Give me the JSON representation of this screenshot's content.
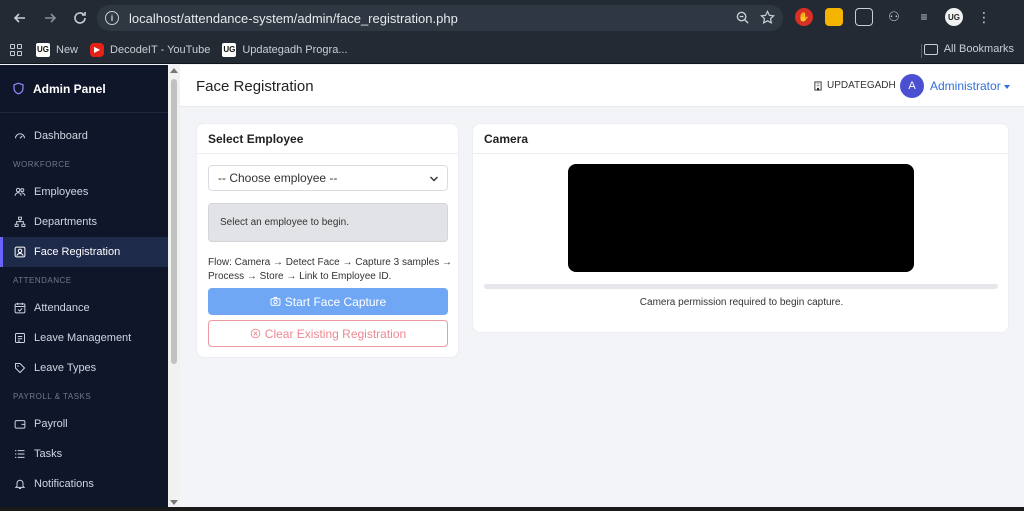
{
  "browser": {
    "url": "localhost/attendance-system/admin/face_registration.php",
    "bookmarks": [
      {
        "label": "New",
        "icon": "ug-favicon"
      },
      {
        "label": "DecodeIT - YouTube",
        "icon": "youtube-favicon"
      },
      {
        "label": "Updategadh Progra...",
        "icon": "ug-favicon"
      }
    ],
    "all_bookmarks": "All Bookmarks",
    "profile_initials": "UG"
  },
  "sidebar": {
    "brand": "Admin Panel",
    "items": [
      {
        "type": "item",
        "label": "Dashboard",
        "icon": "dashboard-icon"
      },
      {
        "type": "section",
        "label": "WORKFORCE"
      },
      {
        "type": "item",
        "label": "Employees",
        "icon": "people-icon"
      },
      {
        "type": "item",
        "label": "Departments",
        "icon": "sitemap-icon"
      },
      {
        "type": "item",
        "label": "Face Registration",
        "icon": "face-id-icon",
        "active": true
      },
      {
        "type": "section",
        "label": "ATTENDANCE"
      },
      {
        "type": "item",
        "label": "Attendance",
        "icon": "calendar-check-icon"
      },
      {
        "type": "item",
        "label": "Leave Management",
        "icon": "clipboard-icon"
      },
      {
        "type": "item",
        "label": "Leave Types",
        "icon": "tag-icon"
      },
      {
        "type": "section",
        "label": "PAYROLL & TASKS"
      },
      {
        "type": "item",
        "label": "Payroll",
        "icon": "wallet-icon"
      },
      {
        "type": "item",
        "label": "Tasks",
        "icon": "list-icon"
      },
      {
        "type": "item",
        "label": "Notifications",
        "icon": "bell-icon"
      }
    ]
  },
  "header": {
    "title": "Face Registration",
    "org": "UPDATEGADH",
    "avatar_initial": "A",
    "user": "Administrator"
  },
  "select_employee": {
    "title": "Select Employee",
    "dropdown_value": "-- Choose employee --",
    "info": "Select an employee to begin.",
    "flow_line1": "Flow: Camera → Detect Face → Capture 3 samples →",
    "flow_line2": "Process → Store → Link to Employee ID.",
    "start_button": "Start Face Capture",
    "clear_button": "Clear Existing Registration"
  },
  "camera": {
    "title": "Camera",
    "progress": 0,
    "status": "Camera permission required to begin capture."
  },
  "colors": {
    "accent": "#6c63ff",
    "primary_button": "#6fa7f5",
    "danger": "#ee8790",
    "sidebar_bg": "#0f1629"
  }
}
